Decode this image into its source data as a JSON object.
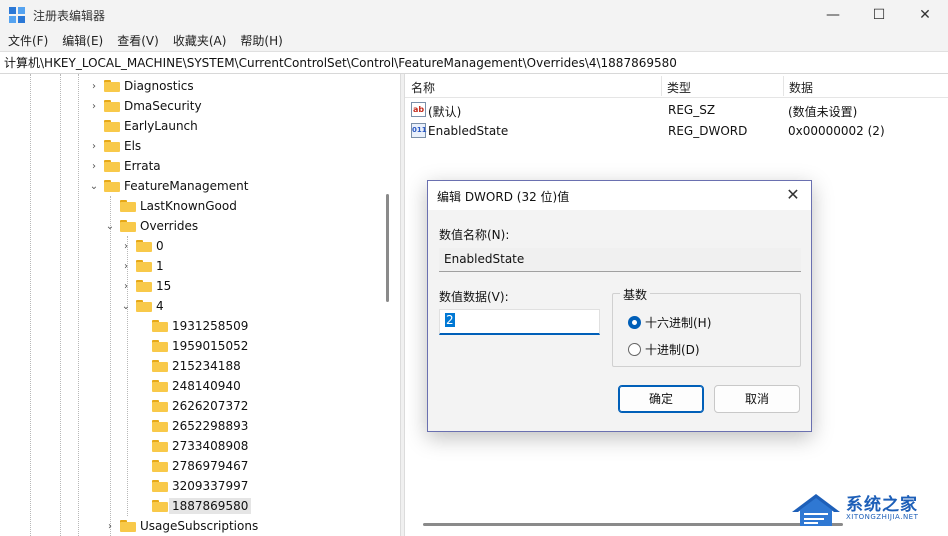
{
  "window": {
    "title": "注册表编辑器",
    "minimize": "—",
    "maximize": "☐",
    "close": "✕"
  },
  "menu": [
    "文件(F)",
    "编辑(E)",
    "查看(V)",
    "收藏夹(A)",
    "帮助(H)"
  ],
  "address": "计算机\\HKEY_LOCAL_MACHINE\\SYSTEM\\CurrentControlSet\\Control\\FeatureManagement\\Overrides\\4\\1887869580",
  "tree": [
    {
      "label": "Diagnostics",
      "chevron": "›"
    },
    {
      "label": "DmaSecurity",
      "chevron": "›"
    },
    {
      "label": "EarlyLaunch",
      "chevron": ""
    },
    {
      "label": "Els",
      "chevron": "›"
    },
    {
      "label": "Errata",
      "chevron": "›"
    },
    {
      "label": "FeatureManagement",
      "chevron": "⌄"
    },
    {
      "label": "LastKnownGood",
      "chevron": ""
    },
    {
      "label": "Overrides",
      "chevron": "⌄"
    },
    {
      "label": "0",
      "chevron": "›"
    },
    {
      "label": "1",
      "chevron": "›"
    },
    {
      "label": "15",
      "chevron": "›"
    },
    {
      "label": "4",
      "chevron": "⌄"
    },
    {
      "label": "1931258509",
      "chevron": ""
    },
    {
      "label": "1959015052",
      "chevron": ""
    },
    {
      "label": "215234188",
      "chevron": ""
    },
    {
      "label": "248140940",
      "chevron": ""
    },
    {
      "label": "2626207372",
      "chevron": ""
    },
    {
      "label": "2652298893",
      "chevron": ""
    },
    {
      "label": "2733408908",
      "chevron": ""
    },
    {
      "label": "2786979467",
      "chevron": ""
    },
    {
      "label": "3209337997",
      "chevron": ""
    },
    {
      "label": "1887869580",
      "chevron": ""
    },
    {
      "label": "UsageSubscriptions",
      "chevron": "›"
    }
  ],
  "list": {
    "columns": {
      "name": "名称",
      "type": "类型",
      "data": "数据"
    },
    "rows": [
      {
        "icon": "ab",
        "name": "(默认)",
        "type": "REG_SZ",
        "data": "(数值未设置)"
      },
      {
        "icon": "011",
        "name": "EnabledState",
        "type": "REG_DWORD",
        "data": "0x00000002 (2)"
      }
    ]
  },
  "dialog": {
    "title": "编辑 DWORD (32 位)值",
    "close": "✕",
    "name_label": "数值名称(N):",
    "name_value": "EnabledState",
    "data_label": "数值数据(V):",
    "data_value": "2",
    "base_label": "基数",
    "radio_hex": "十六进制(H)",
    "radio_dec": "十进制(D)",
    "ok": "确定",
    "cancel": "取消"
  },
  "watermark": {
    "title": "系统之家",
    "subtitle": "XITONGZHIJIA.NET"
  }
}
